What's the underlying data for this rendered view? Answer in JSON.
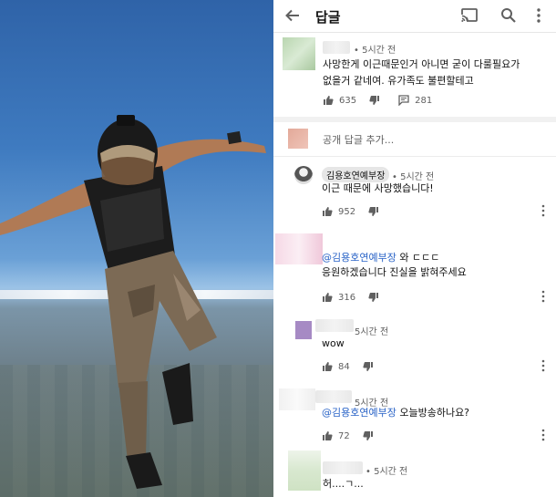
{
  "header": {
    "title": "답글"
  },
  "op_comment": {
    "time": "• 5시간 전",
    "text_line1": "사망한게 이근때문인거 아니면 굳이 다룰필요가",
    "text_line2": "없을거 같네여. 유가족도 불편할테고",
    "likes": "635",
    "replies": "281"
  },
  "reply_box": {
    "placeholder": "공개 답글 추가..."
  },
  "comments": [
    {
      "author": "김용호연예부장",
      "time": "• 5시간 전",
      "text": "이근 때문에 사망했습니다!",
      "likes": "952"
    },
    {
      "mention": "@김용호연예부장",
      "text_after_mention": "와 ㄷㄷㄷ",
      "text_line2": "응원하겠습니다 진실을 밝혀주세요",
      "likes": "316"
    },
    {
      "time": "5시간 전",
      "text": "wow",
      "likes": "84"
    },
    {
      "time": "5시간 전",
      "mention": "@김용호연예부장",
      "text_after_mention": "오늘방송하나요?",
      "likes": "72"
    },
    {
      "time": "• 5시간 전",
      "text": "허....ㄱ..."
    }
  ],
  "colors": {
    "mention": "#2963c7",
    "secondary_text": "#606060",
    "icon": "#606060"
  },
  "icons": {
    "back": "arrow-left",
    "cast": "cast",
    "search": "magnifier",
    "more": "kebab-vertical",
    "like": "thumbs-up",
    "dislike": "thumbs-down",
    "reply": "comment-bubble"
  }
}
